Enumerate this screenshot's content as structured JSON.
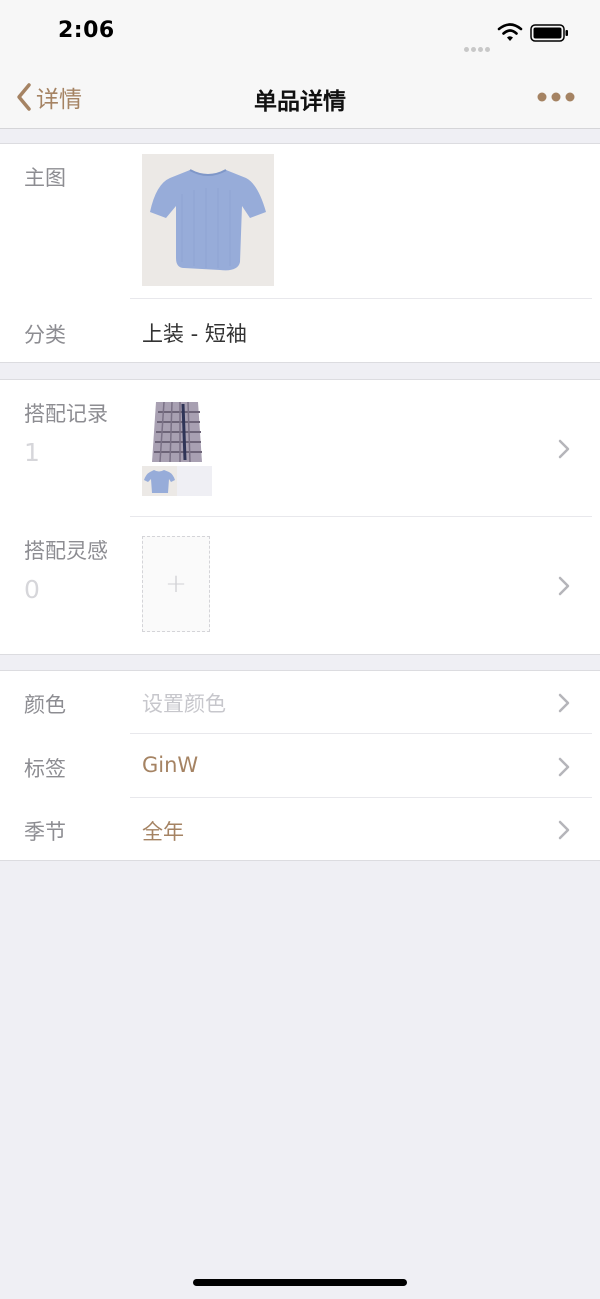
{
  "status_bar": {
    "time": "2:06"
  },
  "nav": {
    "back_label": "详情",
    "title": "单品详情"
  },
  "section_main": {
    "main_image_label": "主图",
    "category_label": "分类",
    "category_value": "上装 - 短袖"
  },
  "section_outfits": {
    "records_label": "搭配记录",
    "records_count": "1",
    "inspiration_label": "搭配灵感",
    "inspiration_count": "0",
    "add_symbol": "+"
  },
  "section_props": {
    "color_label": "颜色",
    "color_value": "设置颜色",
    "tag_label": "标签",
    "tag_value": "GinW",
    "season_label": "季节",
    "season_value": "全年"
  },
  "colors": {
    "accent": "#a58363",
    "label_gray": "#8d8d92",
    "placeholder_gray": "#c7c7cc",
    "background": "#efeff4"
  },
  "icons": [
    "back-chevron-icon",
    "more-dots-icon",
    "chevron-right-icon",
    "wifi-icon",
    "battery-icon",
    "plus-icon"
  ]
}
